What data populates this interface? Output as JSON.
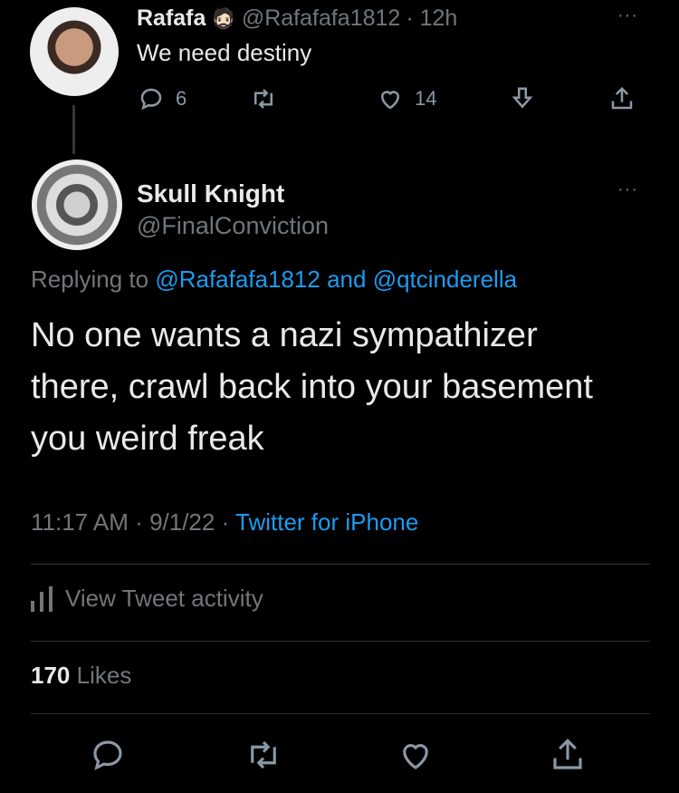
{
  "parent": {
    "name": "Rafafa",
    "emoji": "🧔🏻",
    "handle": "@Rafafafa1812",
    "time": "· 12h",
    "text": "We need destiny",
    "more": "···",
    "replies": "6",
    "likes": "14"
  },
  "main": {
    "name": "Skull Knight",
    "handle": "@FinalConviction",
    "more": "···",
    "replying_prefix": "Replying to",
    "replying_user1": "@Rafafafa1812",
    "replying_and": "and",
    "replying_user2": "@qtcinderella",
    "text": "No one wants a nazi sympathizer there, crawl back into your basement you weird freak",
    "time": "11:17 AM",
    "date": "9/1/22",
    "source": "Twitter for iPhone",
    "activity": "View Tweet activity",
    "likes_count": "170",
    "likes_label": "Likes"
  },
  "colors": {
    "background": "#000000",
    "text": "#e7e9ea",
    "muted": "#71767b",
    "link": "#1d9bf0"
  }
}
